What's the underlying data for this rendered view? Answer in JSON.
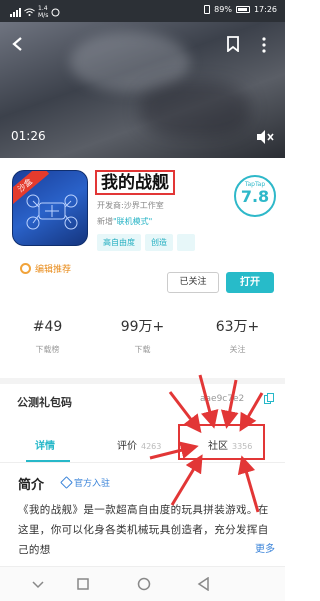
{
  "status_bar": {
    "signal_left": "1.4",
    "speed_unit": "M/s",
    "battery": "89%",
    "clock": "17:26"
  },
  "video": {
    "current_time": "01:26"
  },
  "game": {
    "ribbon": "沙盒",
    "title": "我的战舰",
    "developer": "开发商:沙界工作室",
    "new_prefix": "新增",
    "new_mode": "\"联机模式\"",
    "tags": [
      "高自由度",
      "创造"
    ],
    "score_label": "TapTap",
    "score": "7.8",
    "recommend": "编辑推荐"
  },
  "actions": {
    "follow": "已关注",
    "open": "打开"
  },
  "stats": [
    {
      "value": "#49",
      "label": "下载榜"
    },
    {
      "value": "99万+",
      "label": "下载"
    },
    {
      "value": "63万+",
      "label": "关注"
    }
  ],
  "gift": {
    "label": "公测礼包码",
    "code": "aae9c7e2"
  },
  "tabs": [
    {
      "label": "详情",
      "count": ""
    },
    {
      "label": "评价",
      "count": "4263"
    },
    {
      "label": "社区",
      "count": "3356"
    }
  ],
  "intro": {
    "title": "简介",
    "official": "官方入驻",
    "body": "《我的战舰》是一款超高自由度的玩具拼装游戏。在这里，你可以化身各类机械玩具创造者，充分发挥自己的想",
    "more": "更多"
  },
  "colors": {
    "accent": "#27b8c9",
    "annotation_red": "#e23636",
    "recommend_orange": "#e88b1a"
  }
}
